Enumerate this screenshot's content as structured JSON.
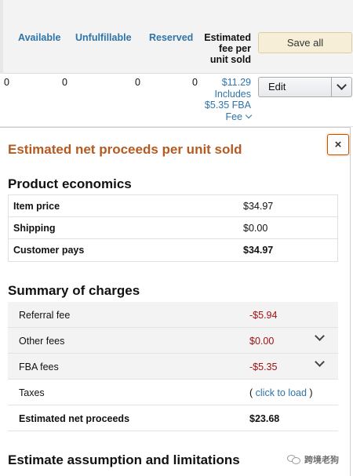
{
  "inventory": {
    "columns": {
      "available": "Available",
      "unfulfillable": "Unfulfillable",
      "reserved": "Reserved",
      "estimated_fee_line1": "Estimated",
      "estimated_fee_line2": "fee per",
      "estimated_fee_line3": "unit sold"
    },
    "save_all_label": "Save all",
    "row": {
      "col0": "0",
      "available": "0",
      "unfulfillable": "0",
      "reserved": "0",
      "fee_line1": "$11.29",
      "fee_line2": "Includes",
      "fee_line3": "$5.35 FBA",
      "fee_line4": "Fee",
      "edit_label": "Edit"
    }
  },
  "panel": {
    "title": "Estimated net proceeds per unit sold",
    "close_label": "×",
    "product_economics": {
      "title": "Product economics",
      "rows": [
        {
          "label": "Item price",
          "value": "$34.97"
        },
        {
          "label": "Shipping",
          "value": "$0.00"
        },
        {
          "label": "Customer pays",
          "value": "$34.97"
        }
      ]
    },
    "summary_of_charges": {
      "title": "Summary of charges",
      "rows": [
        {
          "label": "Referral fee",
          "value": "-$5.94"
        },
        {
          "label": "Other fees",
          "value": "$0.00"
        },
        {
          "label": "FBA fees",
          "value": "-$5.35"
        },
        {
          "label": "Taxes",
          "value_prefix": "( ",
          "value_link": "click to load",
          "value_suffix": " )"
        },
        {
          "label": "Estimated net proceeds",
          "value": "$23.68"
        }
      ]
    },
    "assumptions_title": "Estimate assumption and limitations"
  },
  "watermark": {
    "text": "跨境老狗"
  },
  "colors": {
    "link": "#2e74a8",
    "title_orange": "#b55a20",
    "negative": "#a01111"
  }
}
